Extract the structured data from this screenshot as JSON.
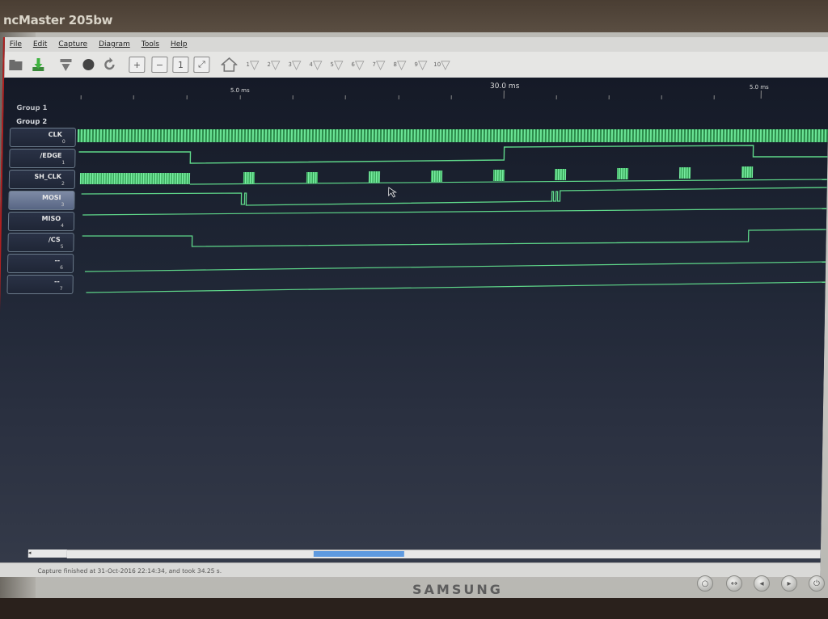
{
  "monitor": {
    "model_label": "ncMaster 205bw",
    "brand": "SAMSUNG"
  },
  "menu": [
    "File",
    "Edit",
    "Capture",
    "Diagram",
    "Tools",
    "Help"
  ],
  "toolbar": {
    "marker_buttons": [
      "1",
      "2",
      "3",
      "4",
      "5",
      "6",
      "7",
      "8",
      "9",
      "10"
    ]
  },
  "ruler": {
    "labels": [
      "5.0 ms",
      "30.0 ms",
      "5.0 ms"
    ]
  },
  "groups": [
    "Group 1",
    "Group 2"
  ],
  "channels": [
    {
      "name": "CLK",
      "index": "0"
    },
    {
      "name": "/EDGE",
      "index": "1"
    },
    {
      "name": "SH_CLK",
      "index": "2"
    },
    {
      "name": "MOSI",
      "index": "3"
    },
    {
      "name": "MISO",
      "index": "4"
    },
    {
      "name": "/CS",
      "index": "5"
    },
    {
      "name": "--",
      "index": "6"
    },
    {
      "name": "--",
      "index": "7"
    }
  ],
  "status": "Capture finished at 31-Oct-2016 22:14:34, and took 34.25 s.",
  "colors": {
    "signal": "#5fd88a",
    "background": "#1e2330",
    "selection": "#5e9ae0"
  }
}
